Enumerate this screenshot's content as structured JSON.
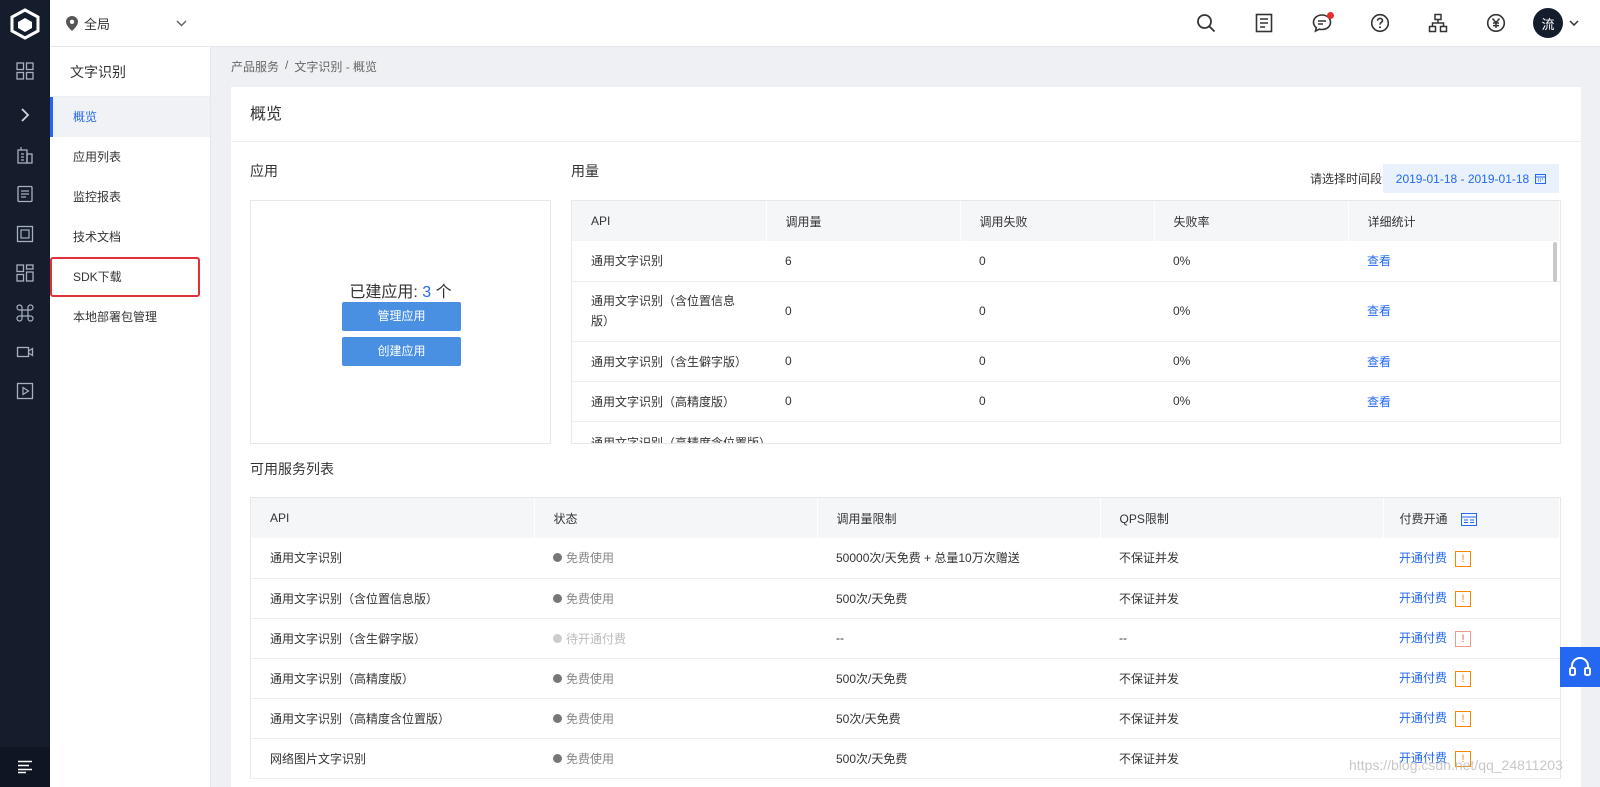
{
  "topbar": {
    "region": "全局",
    "avatar_text": "流",
    "icons": [
      "search-icon",
      "document-icon",
      "message-icon",
      "help-icon",
      "org-chart-icon",
      "billing-icon"
    ]
  },
  "rail": {
    "icons": [
      "dashboard-icon",
      "expand-icon",
      "building-icon",
      "list-icon",
      "storage-icon",
      "apps-icon",
      "command-icon",
      "video-icon",
      "play-icon"
    ],
    "bottom_icon": "menu-icon"
  },
  "sidebar": {
    "title": "文字识别",
    "items": [
      {
        "label": "概览"
      },
      {
        "label": "应用列表"
      },
      {
        "label": "监控报表"
      },
      {
        "label": "技术文档"
      },
      {
        "label": "SDK下载"
      },
      {
        "label": "本地部署包管理"
      }
    ]
  },
  "breadcrumb": {
    "root": "产品服务",
    "sep": "/",
    "current": "文字识别 - 概览"
  },
  "page": {
    "title": "概览"
  },
  "apps": {
    "heading": "应用",
    "count_prefix": "已建应用:",
    "count": "3",
    "count_suffix": "个",
    "manage_button": "管理应用",
    "create_button": "创建应用"
  },
  "usage": {
    "heading": "用量",
    "date_label": "请选择时间段",
    "date_range": "2019-01-18 - 2019-01-18",
    "columns": [
      "API",
      "调用量",
      "调用失败",
      "失败率",
      "详细统计"
    ],
    "rows": [
      {
        "api": "通用文字识别",
        "calls": "6",
        "failed": "0",
        "rate": "0%",
        "detail": "查看"
      },
      {
        "api": "通用文字识别（含位置信息版）",
        "calls": "0",
        "failed": "0",
        "rate": "0%",
        "detail": "查看"
      },
      {
        "api": "通用文字识别（含生僻字版）",
        "calls": "0",
        "failed": "0",
        "rate": "0%",
        "detail": "查看"
      },
      {
        "api": "通用文字识别（高精度版）",
        "calls": "0",
        "failed": "0",
        "rate": "0%",
        "detail": "查看"
      },
      {
        "api": "通用文字识别（高精度含位置版）",
        "calls": "",
        "failed": "",
        "rate": "",
        "detail": ""
      }
    ]
  },
  "services": {
    "heading": "可用服务列表",
    "columns": [
      "API",
      "状态",
      "调用量限制",
      "QPS限制",
      "付费开通"
    ],
    "rows": [
      {
        "api": "通用文字识别",
        "status": "免费使用",
        "limit": "50000次/天免费 + 总量10万次赠送",
        "qps": "不保证并发",
        "action": "开通付费"
      },
      {
        "api": "通用文字识别（含位置信息版）",
        "status": "免费使用",
        "limit": "500次/天免费",
        "qps": "不保证并发",
        "action": "开通付费"
      },
      {
        "api": "通用文字识别（含生僻字版）",
        "status": "待开通付费",
        "limit": "--",
        "qps": "--",
        "action": "开通付费"
      },
      {
        "api": "通用文字识别（高精度版）",
        "status": "免费使用",
        "limit": "500次/天免费",
        "qps": "不保证并发",
        "action": "开通付费"
      },
      {
        "api": "通用文字识别（高精度含位置版）",
        "status": "免费使用",
        "limit": "50次/天免费",
        "qps": "不保证并发",
        "action": "开通付费"
      },
      {
        "api": "网络图片文字识别",
        "status": "免费使用",
        "limit": "500次/天免费",
        "qps": "不保证并发",
        "action": "开通付费"
      }
    ]
  },
  "watermark": "https://blog.csdn.net/qq_24811203",
  "colors": {
    "primary": "#2468f2",
    "button": "#4a90e2",
    "dark_nav": "#151d2d",
    "highlight_border": "#e0303a",
    "warning": "#f38900"
  }
}
